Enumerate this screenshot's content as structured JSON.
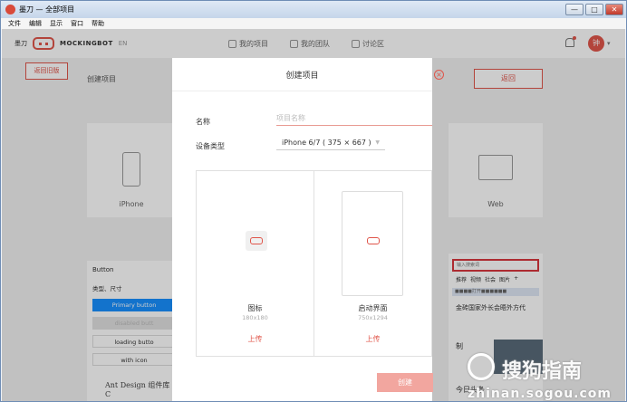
{
  "window": {
    "title": "墨刀 — 全部项目",
    "min": "—",
    "max": "□",
    "close": "✕"
  },
  "menu": [
    "文件",
    "编辑",
    "显示",
    "窗口",
    "帮助"
  ],
  "nav": {
    "brand_cn": "墨刀",
    "brand": "MOCKINGBOT",
    "lang": "EN",
    "links": [
      "我的项目",
      "我的团队",
      "讨论区"
    ],
    "avatar": "钟",
    "caret": "▾"
  },
  "page": {
    "back_old": "返回旧版",
    "heading": "创建项目",
    "back": "返回"
  },
  "cards": {
    "iphone": "iPhone",
    "web": "Web"
  },
  "panel_left": {
    "head": "Button",
    "sub": "类型、尺寸",
    "primary": "Primary button",
    "disabled": "disabled butt",
    "loading": "loading butto",
    "with_icon": "with icon",
    "antd": "Ant Design 组件库 C"
  },
  "panel_right": {
    "search": "输入搜索词",
    "tabs": [
      "推荐",
      "视频",
      "社会",
      "图片",
      "+"
    ],
    "bar": "■■■■打开■■■■■■",
    "news1": "金砖国家外长会晤外方代",
    "news2": "制",
    "news3": "今日头条"
  },
  "modal": {
    "title": "创建项目",
    "close": "×",
    "name_label": "名称",
    "name_placeholder": "项目名称",
    "name_value": "",
    "device_label": "设备类型",
    "device_value": "iPhone 6/7 ( 375 × 667 )",
    "device_caret": "▼",
    "icon_name": "图标",
    "icon_size": "180x180",
    "icon_upload": "上传",
    "launch_name": "启动界面",
    "launch_size": "750x1294",
    "launch_upload": "上传",
    "create": "创建"
  },
  "watermark": {
    "cn": "搜狗指南",
    "url": "zhinan.sogou.com"
  },
  "colors": {
    "accent": "#e0554a",
    "primary": "#1890ff",
    "create_disabled": "#f2a69f"
  }
}
